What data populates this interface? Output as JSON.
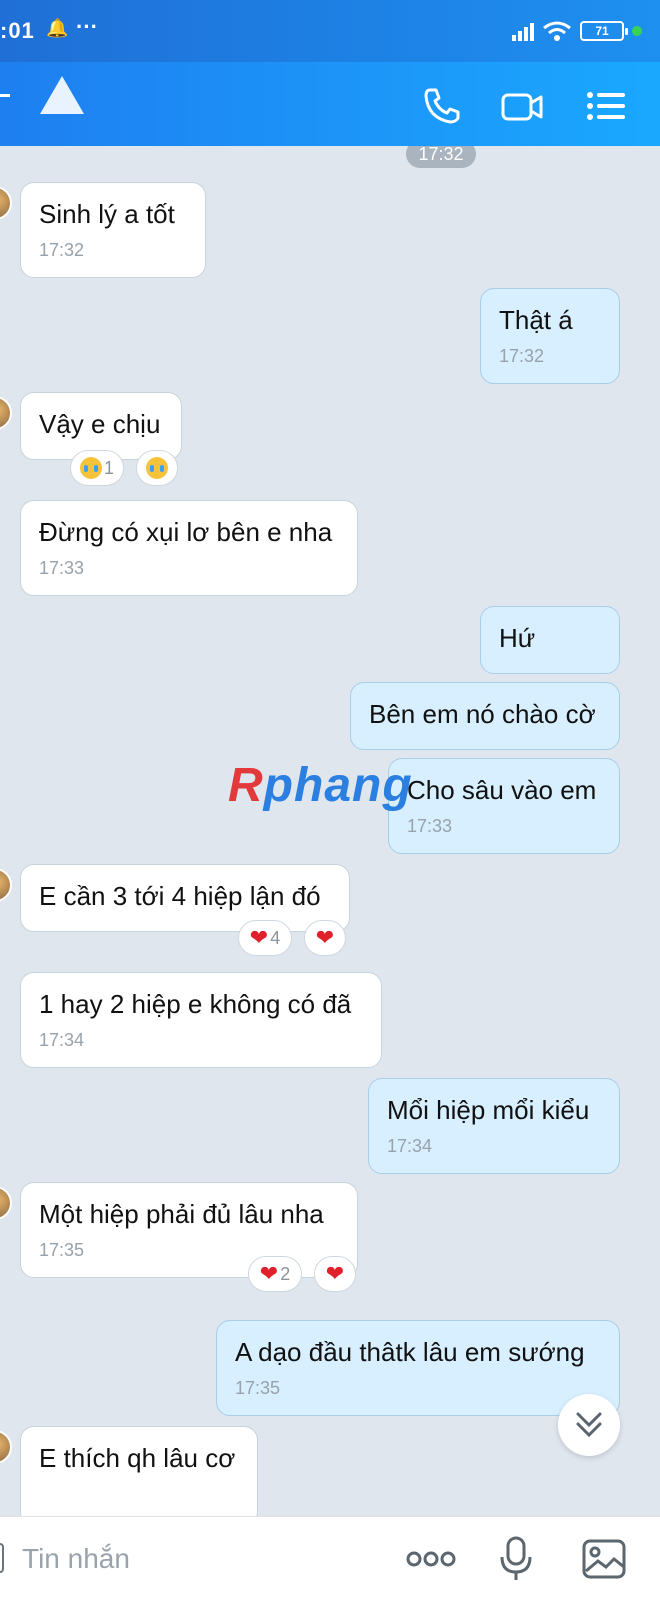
{
  "status_bar": {
    "time": ":01",
    "battery": "71"
  },
  "chat": {
    "time_chip": "17:32",
    "messages": [
      {
        "side": "in",
        "text": "Sinh lý a tốt",
        "time": "17:32"
      },
      {
        "side": "out",
        "text": "Thật á",
        "time": "17:32"
      },
      {
        "side": "in",
        "text": "Vậy e chịu",
        "time": ""
      },
      {
        "side": "in",
        "text": "Đừng có xụi lơ bên e nha",
        "time": "17:33"
      },
      {
        "side": "out",
        "text": "Hứ",
        "time": ""
      },
      {
        "side": "out",
        "text": "Bên em nó chào cờ",
        "time": ""
      },
      {
        "side": "out",
        "text": "Cho sâu vào em",
        "time": "17:33"
      },
      {
        "side": "in",
        "text": "E cần 3 tới 4 hiệp lận đó",
        "time": ""
      },
      {
        "side": "in",
        "text": "1 hay 2 hiệp e không có đã",
        "time": "17:34"
      },
      {
        "side": "out",
        "text": "Mổi hiệp mổi kiểu",
        "time": "17:34"
      },
      {
        "side": "in",
        "text": "Một hiệp phải đủ lâu nha",
        "time": "17:35"
      },
      {
        "side": "out",
        "text": "A dạo đầu thâtk lâu em sướng",
        "time": "17:35"
      },
      {
        "side": "in",
        "text": "E thích qh lâu cơ",
        "time": ""
      }
    ],
    "reactions": {
      "vay_e_chiu": {
        "count": "1",
        "emoji": "crying-face"
      },
      "e_can": {
        "count": "4",
        "emoji": "heart"
      },
      "mot_hiep": {
        "count": "2",
        "emoji": "heart"
      }
    }
  },
  "watermark": {
    "first": "R",
    "rest": "phang"
  },
  "composer": {
    "placeholder": "Tin nhắn"
  }
}
